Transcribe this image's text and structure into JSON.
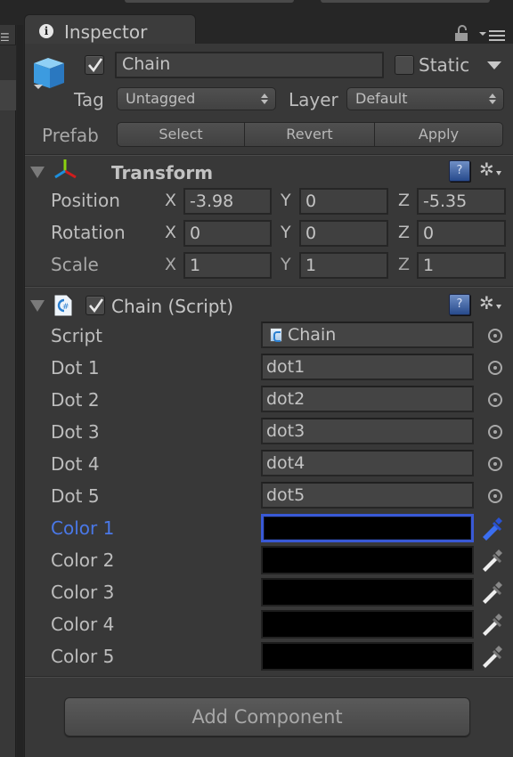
{
  "window": {
    "tab_title": "Inspector",
    "icons": [
      "info-icon",
      "lock-icon",
      "panel-menu-icon",
      "hamburger-icon"
    ]
  },
  "gameobject": {
    "active": true,
    "name": "Chain",
    "static_checked": false,
    "static_label": "Static",
    "tag_label": "Tag",
    "tag_value": "Untagged",
    "layer_label": "Layer",
    "layer_value": "Default",
    "prefab_label": "Prefab",
    "prefab_buttons": [
      "Select",
      "Revert",
      "Apply"
    ]
  },
  "transform": {
    "title": "Transform",
    "rows": [
      {
        "label": "Position",
        "x": "-3.98",
        "y": "0",
        "z": "-5.35"
      },
      {
        "label": "Rotation",
        "x": "0",
        "y": "0",
        "z": "0"
      },
      {
        "label": "Scale",
        "x": "1",
        "y": "1",
        "z": "1"
      }
    ],
    "axis_labels": [
      "X",
      "Y",
      "Z"
    ]
  },
  "script_component": {
    "enabled": true,
    "title": "Chain (Script)",
    "script_label": "Script",
    "script_value": "Chain",
    "dots": [
      {
        "label": "Dot 1",
        "value": "dot1"
      },
      {
        "label": "Dot 2",
        "value": "dot2"
      },
      {
        "label": "Dot 3",
        "value": "dot3"
      },
      {
        "label": "Dot 4",
        "value": "dot4"
      },
      {
        "label": "Dot 5",
        "value": "dot5"
      }
    ],
    "colors": [
      {
        "label": "Color 1",
        "value": "#000000",
        "focused": true
      },
      {
        "label": "Color 2",
        "value": "#000000",
        "focused": false
      },
      {
        "label": "Color 3",
        "value": "#000000",
        "focused": false
      },
      {
        "label": "Color 4",
        "value": "#000000",
        "focused": false
      },
      {
        "label": "Color 5",
        "value": "#000000",
        "focused": false
      }
    ]
  },
  "footer": {
    "add_component_label": "Add Component"
  },
  "theme": {
    "focus_color": "#4a78e8",
    "panel_bg": "#383838"
  }
}
